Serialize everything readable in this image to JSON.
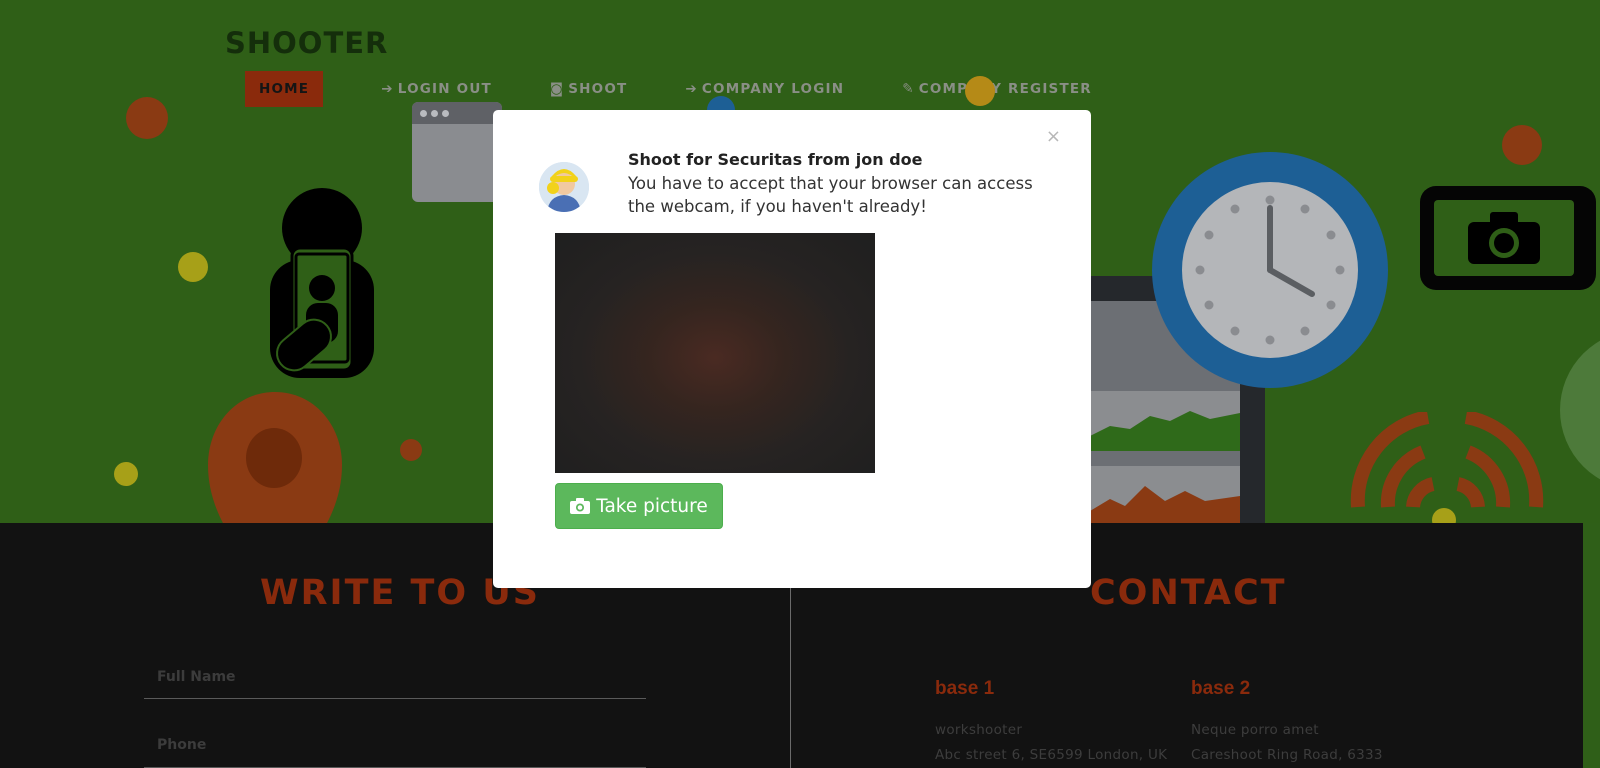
{
  "brand": "SHOOTER",
  "nav": {
    "items": [
      {
        "label": "HOME",
        "icon": ""
      },
      {
        "label": "LOGIN OUT",
        "icon": "login-icon"
      },
      {
        "label": "SHOOT",
        "icon": "camera-icon"
      },
      {
        "label": "COMPANY LOGIN",
        "icon": "login-icon"
      },
      {
        "label": "COMPANY REGISTER",
        "icon": "edit-icon"
      }
    ],
    "active": "HOME"
  },
  "modal": {
    "close": "×",
    "title": "Shoot for Securitas from jon doe",
    "text": "You have to accept that your browser can access the webcam, if you haven't already!",
    "button": "Take picture",
    "button_icon": "camera-icon"
  },
  "write": {
    "title": "WRITE TO US",
    "fields": [
      {
        "label": "Full Name"
      },
      {
        "label": "Phone"
      }
    ]
  },
  "contact": {
    "title": "CONTACT",
    "bases": [
      {
        "title": "base 1",
        "lines": [
          "workshooter",
          "Abc street 6, SE6599 London, UK"
        ]
      },
      {
        "title": "base 2",
        "lines": [
          "Neque porro amet",
          "Careshoot Ring Road, 6333"
        ]
      }
    ]
  },
  "colors": {
    "hero_bg": "#2f5f17",
    "accent": "#8a2a0c",
    "dark_bg": "#121212",
    "button_green": "#5cb85c"
  }
}
